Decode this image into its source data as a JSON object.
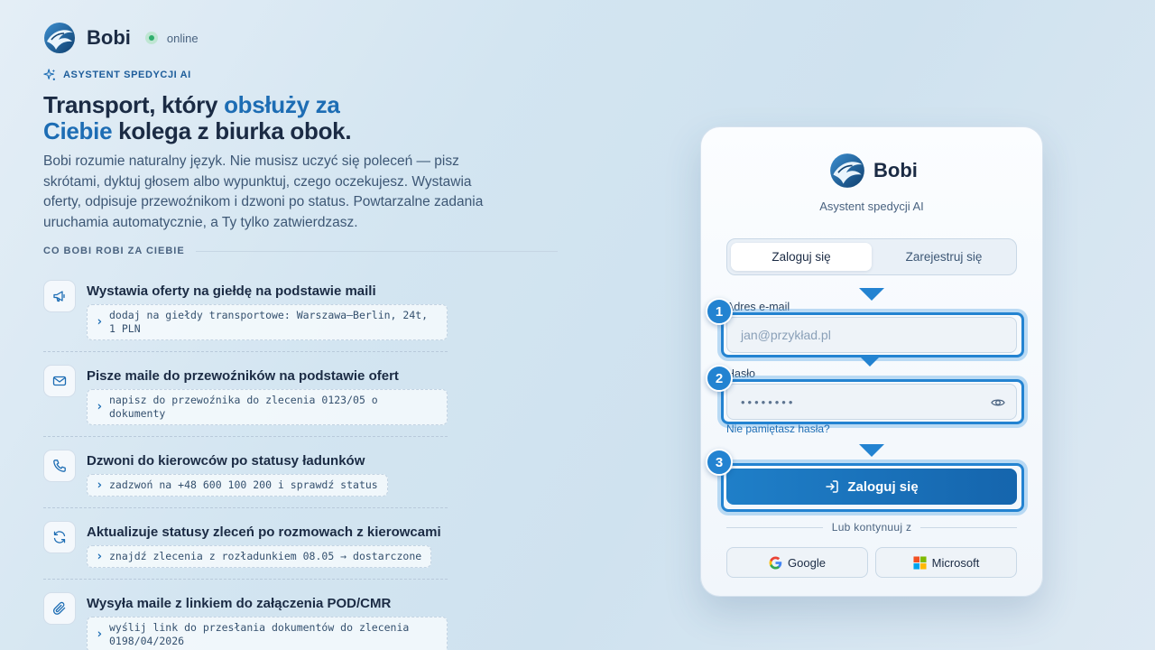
{
  "brand": {
    "name": "Bobi",
    "status": "online"
  },
  "hero": {
    "eyebrow": "ASYSTENT SPEDYCJI AI",
    "headline_part1": "Transport, który ",
    "headline_accent": "obsłuży za Ciebie",
    "headline_part2": " kolega z biurka obok.",
    "lead": "Bobi rozumie naturalny język. Nie musisz uczyć się poleceń — pisz skrótami, dyktuj głosem albo wypunktuj, czego oczekujesz. Wystawia oferty, odpisuje przewoźnikom i dzwoni po status. Powtarzalne zadania uruchamia automatycznie, a Ty tylko zatwierdzasz."
  },
  "section_label": "CO BOBI ROBI ZA CIEBIE",
  "features": [
    {
      "icon": "megaphone-icon",
      "title": "Wystawia oferty na giełdę na podstawie maili",
      "command": "dodaj na giełdy transportowe: Warszawa–Berlin, 24t, 1 PLN"
    },
    {
      "icon": "mail-icon",
      "title": "Pisze maile do przewoźników na podstawie ofert",
      "command": "napisz do przewoźnika do zlecenia 0123/05 o dokumenty"
    },
    {
      "icon": "phone-icon",
      "title": "Dzwoni do kierowców po statusy ładunków",
      "command": "zadzwoń na +48 600 100 200 i sprawdź status"
    },
    {
      "icon": "refresh-icon",
      "title": "Aktualizuje statusy zleceń po rozmowach z kierowcami",
      "command": "znajdź zlecenia z rozładunkiem 08.05 → dostarczone"
    },
    {
      "icon": "paperclip-icon",
      "title": "Wysyła maile z linkiem do załączenia POD/CMR",
      "command": "wyślij link do przesłania dokumentów do zlecenia 0198/04/2026"
    }
  ],
  "login": {
    "brand_name": "Bobi",
    "subtitle": "Asystent spedycji AI",
    "tab_login": "Zaloguj się",
    "tab_register": "Zarejestruj się",
    "email_label": "Adres e-mail",
    "email_placeholder": "jan@przykład.pl",
    "password_label": "Hasło",
    "password_value": "••••••••",
    "forgot": "Nie pamiętasz hasła?",
    "submit": "Zaloguj się",
    "divider": "Lub kontynuuj z",
    "google": "Google",
    "microsoft": "Microsoft",
    "step_badges": [
      "1",
      "2",
      "3"
    ]
  },
  "colors": {
    "accent": "#1d6db4",
    "highlight": "#2383d1",
    "online": "#2fae6d",
    "text": "#1b2b44"
  }
}
